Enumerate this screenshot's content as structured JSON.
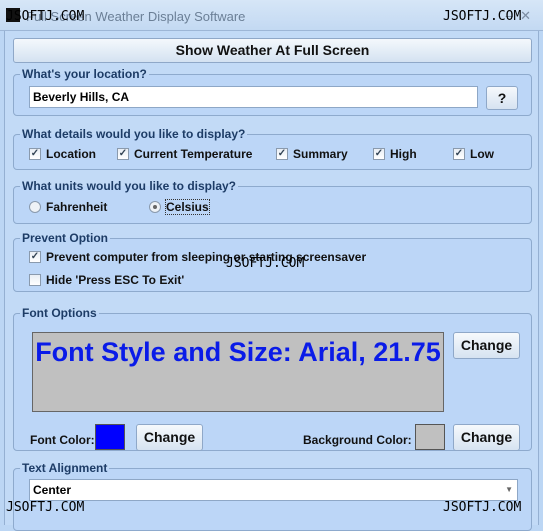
{
  "window": {
    "title": "Full Screen Weather Display Software",
    "watermark": "JSOFTJ.COM",
    "minimize": "–",
    "close": "✕"
  },
  "show_button": "Show Weather At Full Screen",
  "location": {
    "legend": "What's your location?",
    "value": "Beverly Hills, CA",
    "help_button": "?"
  },
  "details": {
    "legend": "What details would you like to display?",
    "items": [
      {
        "label": "Location",
        "checked": true
      },
      {
        "label": "Current Temperature",
        "checked": true
      },
      {
        "label": "Summary",
        "checked": true
      },
      {
        "label": "High",
        "checked": true
      },
      {
        "label": "Low",
        "checked": true
      }
    ]
  },
  "units": {
    "legend": "What units would you like to display?",
    "options": [
      {
        "label": "Fahrenheit",
        "selected": false
      },
      {
        "label": "Celsius",
        "selected": true
      }
    ]
  },
  "prevent": {
    "legend": "Prevent Option",
    "items": [
      {
        "label": "Prevent computer from sleeping or starting screensaver",
        "checked": true
      },
      {
        "label": "Hide 'Press ESC To Exit'",
        "checked": false
      }
    ]
  },
  "font": {
    "legend": "Font Options",
    "preview": "Font Style and Size: Arial, 21.75",
    "change": "Change",
    "font_color_label": "Font Color:",
    "font_color": "#0000ff",
    "bg_color_label": "Background Color:",
    "bg_color": "#c0c0c0"
  },
  "alignment": {
    "legend": "Text Alignment",
    "value": "Center"
  }
}
